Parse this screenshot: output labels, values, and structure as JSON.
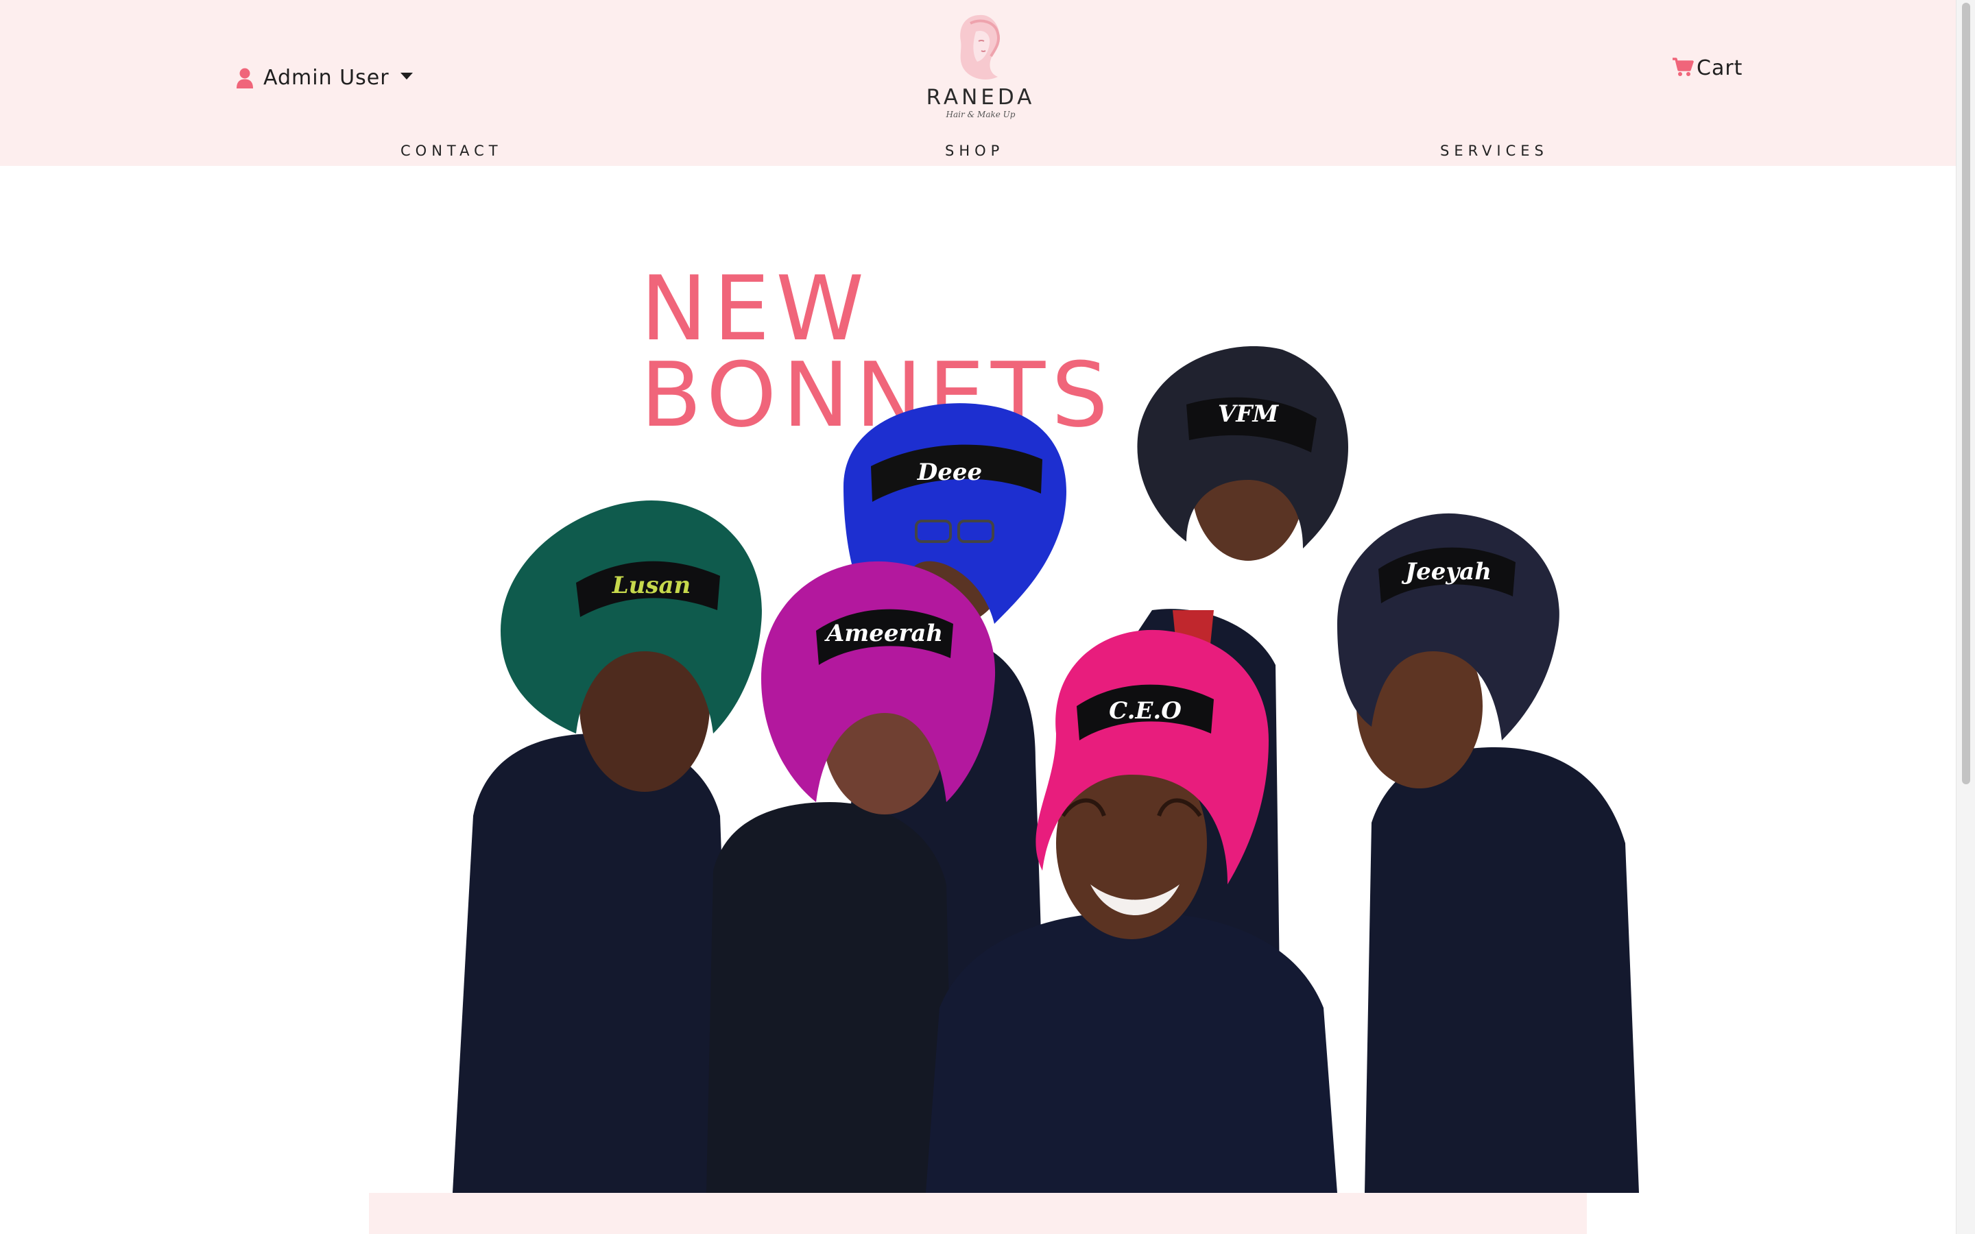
{
  "header": {
    "user_label": "Admin User",
    "brand": "RANEDA",
    "tagline": "Hair & Make Up",
    "cart_label": "Cart",
    "nav": [
      {
        "label": "CONTACT"
      },
      {
        "label": "SHOP"
      },
      {
        "label": "SERVICES"
      }
    ]
  },
  "hero": {
    "title_line1": "NEW",
    "title_line2": "BONNETS",
    "bonnet_names": [
      "Lusan",
      "Ameerah",
      "Deee",
      "VFM",
      "C.E.O",
      "Jeeyah"
    ]
  },
  "colors": {
    "accent": "#f0657a",
    "header_bg": "#fdeeee",
    "text": "#1f1f1f"
  },
  "icons": {
    "user": "user-icon",
    "cart": "cart-icon",
    "caret": "caret-down-icon",
    "logo": "face-logo-icon"
  }
}
